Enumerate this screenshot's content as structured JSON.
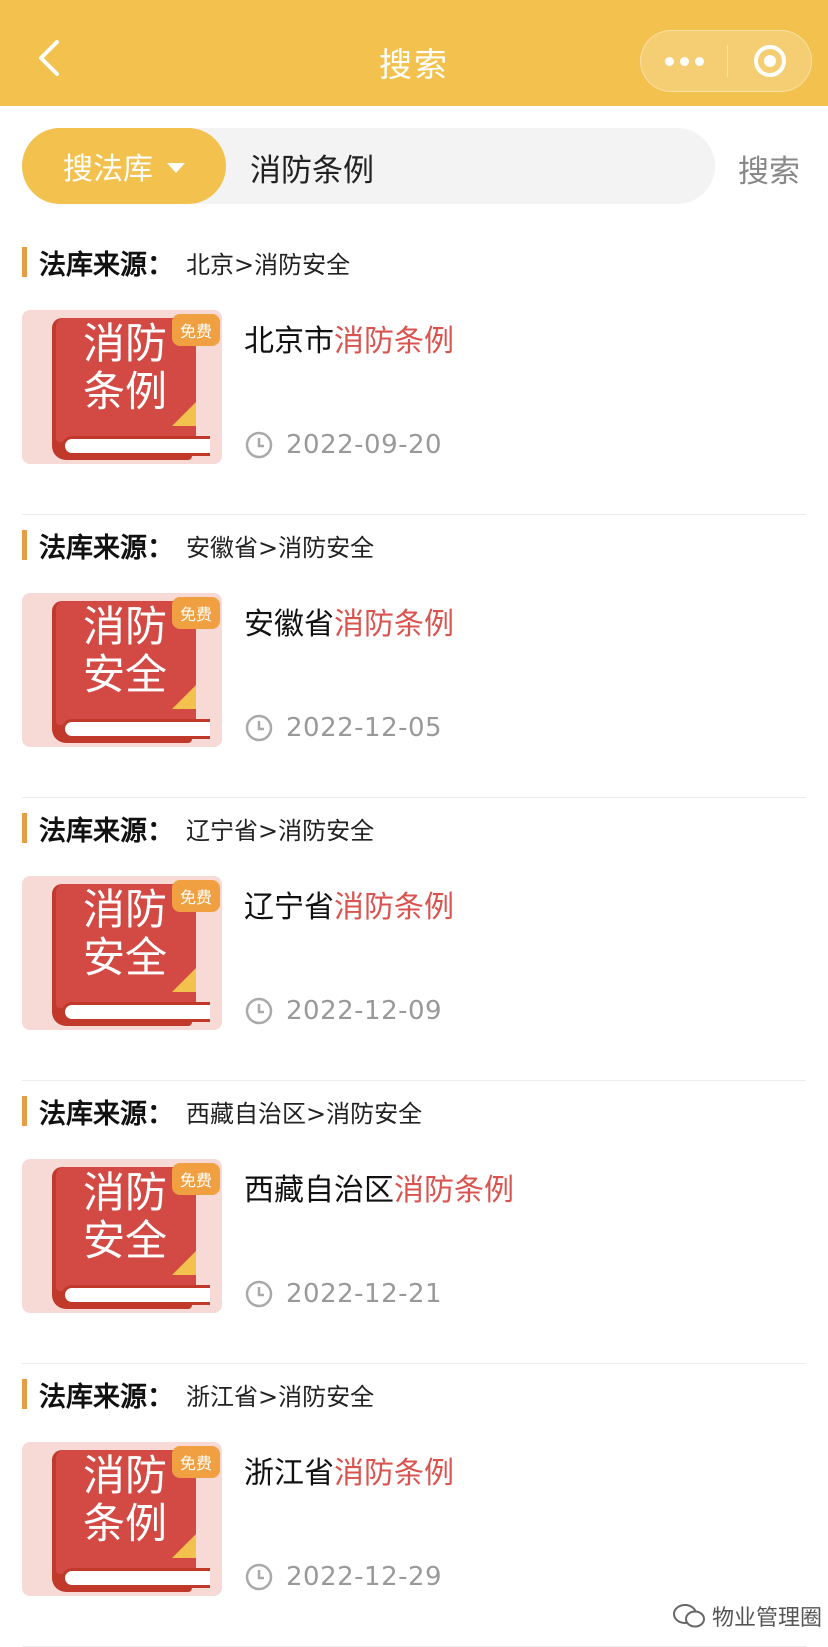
{
  "header": {
    "title": "搜索",
    "back_icon": "chevron-left-icon",
    "more_icon": "more-dots-icon",
    "close_icon": "target-close-icon",
    "bg_color": "#f2c14e"
  },
  "search": {
    "scope_label": "搜法库",
    "query": "消防条例",
    "action_label": "搜索"
  },
  "results": [
    {
      "source_label": "法库来源：",
      "source_path": "北京>消防安全",
      "badge": "免费",
      "cover_text": "消防条例",
      "title_prefix": "北京市",
      "title_highlight": "消防条例",
      "date": "2022-09-20"
    },
    {
      "source_label": "法库来源：",
      "source_path": "安徽省>消防安全",
      "badge": "免费",
      "cover_text": "消防安全",
      "title_prefix": "安徽省",
      "title_highlight": "消防条例",
      "date": "2022-12-05"
    },
    {
      "source_label": "法库来源：",
      "source_path": "辽宁省>消防安全",
      "badge": "免费",
      "cover_text": "消防安全",
      "title_prefix": "辽宁省",
      "title_highlight": "消防条例",
      "date": "2022-12-09"
    },
    {
      "source_label": "法库来源：",
      "source_path": "西藏自治区>消防安全",
      "badge": "免费",
      "cover_text": "消防安全",
      "title_prefix": "西藏自治区",
      "title_highlight": "消防条例",
      "date": "2022-12-21"
    },
    {
      "source_label": "法库来源：",
      "source_path": "浙江省>消防安全",
      "badge": "免费",
      "cover_text": "消防条例",
      "title_prefix": "浙江省",
      "title_highlight": "消防条例",
      "date": "2022-12-29"
    }
  ],
  "watermark": {
    "text": "物业管理圈",
    "icon": "wechat-icon"
  },
  "colors": {
    "accent": "#f2c14e",
    "highlight": "#d9534f",
    "badge": "#f0a040"
  }
}
